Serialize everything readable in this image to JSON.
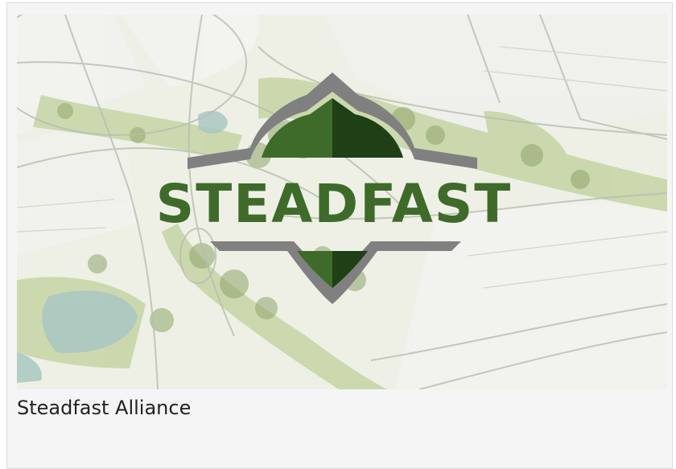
{
  "card": {
    "image_alt": "Steadfast Alliance logo over landscape site plan sketch",
    "logo_text": "STEADFAST",
    "caption": "Steadfast Alliance"
  },
  "colors": {
    "logo_green": "#3f6b2a",
    "logo_dark_green": "#1f3f17",
    "logo_gray": "#808080",
    "caption_text": "#222222"
  },
  "icons": [
    "shield-logo"
  ]
}
